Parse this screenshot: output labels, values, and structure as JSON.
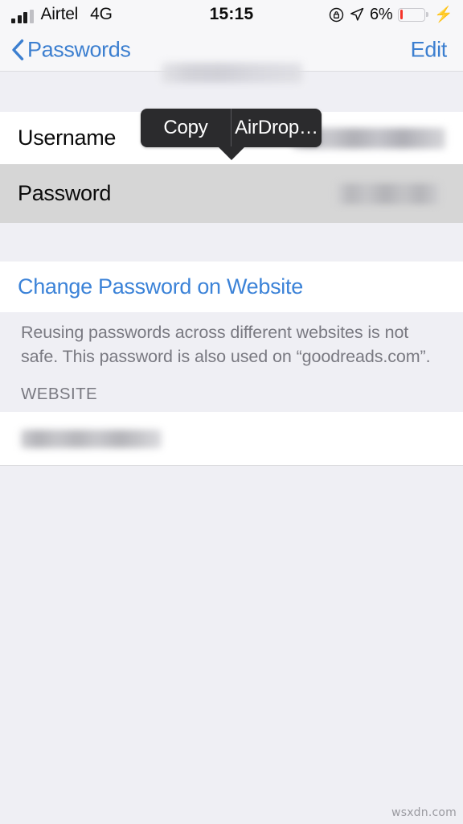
{
  "status_bar": {
    "carrier": "Airtel",
    "network": "4G",
    "time": "15:15",
    "battery_percent": "6%",
    "battery_level": 6,
    "charging": true,
    "bolt_glyph": "⚡",
    "rotation_lock_icon": "rotation-lock-icon",
    "location_icon": "location-arrow-icon",
    "signal_bars_filled": 3,
    "signal_bars_total": 4
  },
  "nav_bar": {
    "back_label": "Passwords",
    "back_icon": "chevron-left-icon",
    "title_redacted": true,
    "edit_label": "Edit"
  },
  "popup_menu": {
    "items": [
      {
        "label": "Copy"
      },
      {
        "label": "AirDrop…"
      }
    ]
  },
  "account_section": {
    "rows": [
      {
        "label": "Username",
        "value_redacted": true,
        "selected": false
      },
      {
        "label": "Password",
        "value_redacted": true,
        "selected": true
      }
    ]
  },
  "change_password": {
    "label": "Change Password on Website"
  },
  "warning": {
    "text": "Reusing passwords across different websites is not safe. This password is also used on “goodreads.com”."
  },
  "website_section": {
    "header": "WEBSITE",
    "value_redacted": true
  },
  "watermark": {
    "text": "wsxdn.com"
  },
  "colors": {
    "accent_blue": "#3C7FD0",
    "link_blue": "#3C83D8",
    "battery_red": "#F5342A",
    "popup_bg": "#2B2B2D",
    "page_bg": "#EFEFF4",
    "row_selected": "#D6D6D6"
  }
}
